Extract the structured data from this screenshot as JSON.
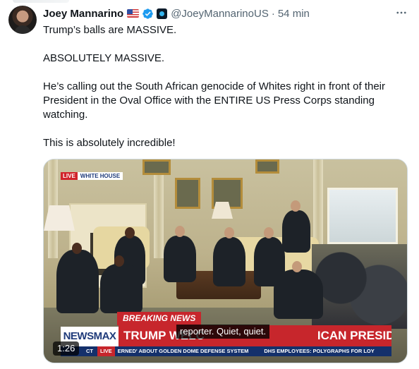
{
  "author": {
    "display_name": "Joey Mannarino",
    "flag_icon": "us-flag-icon",
    "badges": [
      "verified-icon",
      "affiliate-icon"
    ],
    "handle": "@JoeyMannarinoUS",
    "separator": "·",
    "timestamp": "54 min"
  },
  "more_button": {
    "label": "···"
  },
  "tweet": {
    "paragraphs": [
      "Trump’s balls are MASSIVE.",
      "ABSOLUTELY MASSIVE.",
      "He’s calling out the South African genocide of Whites right in front of their President in the Oval Office with the ENTIRE US Press Corps standing watching.",
      "This is absolutely incredible!"
    ]
  },
  "video": {
    "duration": "1:26",
    "overlay": {
      "live_label": "LIVE",
      "location_label": "WHITE HOUSE",
      "breaking": "BREAKING NEWS",
      "network_logo": "NEWSMAX",
      "headline": "TRUMP WELC",
      "headline_tail": "ICAN PRESIDENT TO WH",
      "caption": "reporter. Quiet, quiet.",
      "ticker_prefix": "CT",
      "ticker_live": "LIVE",
      "ticker_item_1": "ERNED' ABOUT GOLDEN DOME DEFENSE SYSTEM",
      "ticker_item_2": "DHS EMPLOYEES: POLYGRAPHS FOR LOY"
    }
  },
  "colors": {
    "text_primary": "#0f1419",
    "text_secondary": "#536471",
    "verified_blue": "#1d9bf0",
    "newsmax_red": "#c7262c",
    "newsmax_blue": "#14306b"
  }
}
